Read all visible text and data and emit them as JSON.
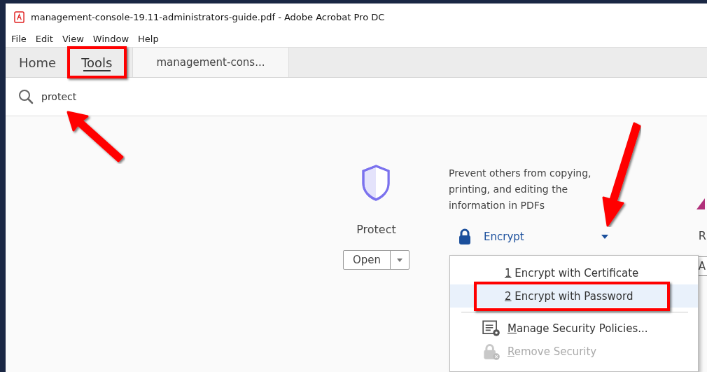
{
  "window": {
    "title": "management-console-19.11-administrators-guide.pdf - Adobe Acrobat Pro DC"
  },
  "menu_bar": [
    "File",
    "Edit",
    "View",
    "Window",
    "Help"
  ],
  "tabs": [
    {
      "label": "Home",
      "selected": false,
      "kind": "plain",
      "annotated": false
    },
    {
      "label": "Tools",
      "selected": true,
      "kind": "plain",
      "annotated": true
    },
    {
      "label": "management-cons...",
      "selected": false,
      "kind": "document",
      "annotated": false
    }
  ],
  "search": {
    "value": "protect",
    "arrow": true
  },
  "tool": {
    "name": "Protect",
    "open_button": "Open"
  },
  "description": "Prevent others from copying, printing, and editing the information in PDFs",
  "encrypt": {
    "label": "Encrypt",
    "expanded": true,
    "arrow": true
  },
  "encrypt_menu": [
    {
      "kind": "item",
      "key": "1",
      "label": "Encrypt with Certificate",
      "selected": false,
      "annotated": false,
      "disabled": false
    },
    {
      "kind": "item",
      "key": "2",
      "label": "Encrypt with Password",
      "selected": true,
      "annotated": true,
      "disabled": false
    },
    {
      "kind": "separator"
    },
    {
      "kind": "policies",
      "key": "M",
      "label": "anage Security Policies...",
      "selected": false,
      "annotated": false,
      "disabled": false
    },
    {
      "kind": "remove",
      "key": "R",
      "label": "emove Security",
      "selected": false,
      "annotated": false,
      "disabled": true
    }
  ],
  "next_tool": {
    "name": "R",
    "button": "A"
  }
}
